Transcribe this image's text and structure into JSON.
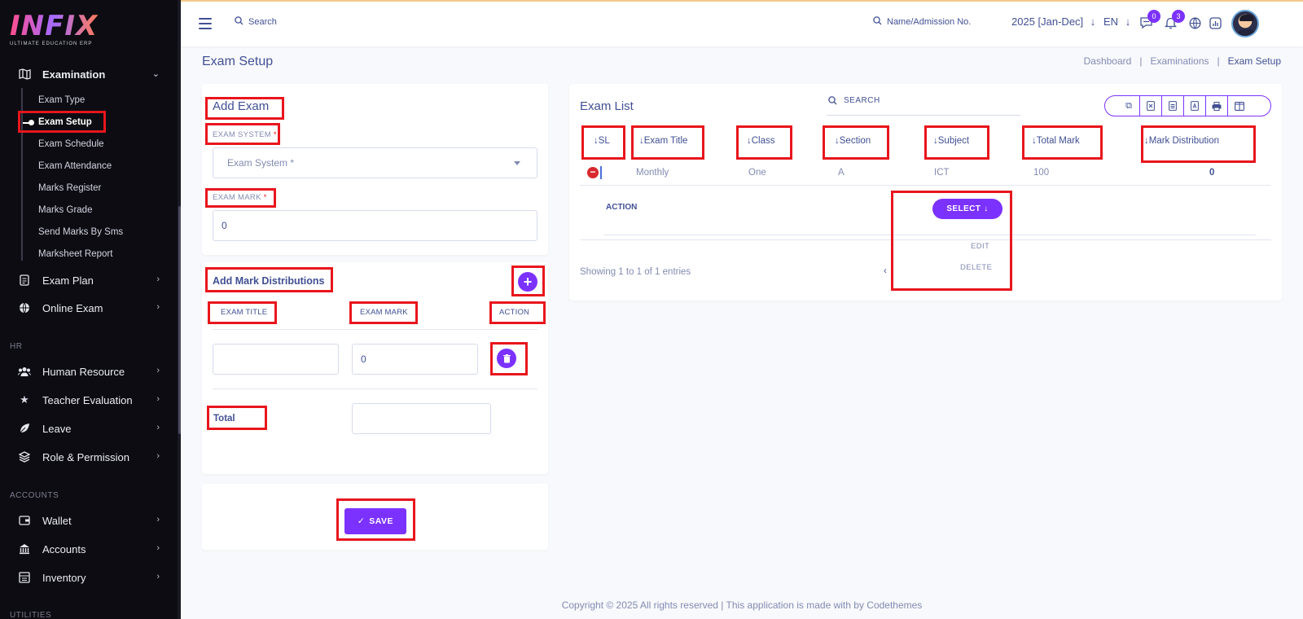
{
  "app": {
    "logo_text": "INFIX",
    "logo_sub": "ULTIMATE EDUCATION ERP"
  },
  "sidebar": {
    "examination": {
      "label": "Examination"
    },
    "sub_items": [
      {
        "label": "Exam Type"
      },
      {
        "label": "Exam Setup"
      },
      {
        "label": "Exam Schedule"
      },
      {
        "label": "Exam Attendance"
      },
      {
        "label": "Marks Register"
      },
      {
        "label": "Marks Grade"
      },
      {
        "label": "Send Marks By Sms"
      },
      {
        "label": "Marksheet Report"
      }
    ],
    "exam_plan": {
      "label": "Exam Plan"
    },
    "online_exam": {
      "label": "Online Exam"
    },
    "hr_section": "HR",
    "human_resource": {
      "label": "Human Resource"
    },
    "teacher_evaluation": {
      "label": "Teacher Evaluation"
    },
    "leave": {
      "label": "Leave"
    },
    "role_permission": {
      "label": "Role & Permission"
    },
    "accounts_section": "ACCOUNTS",
    "wallet": {
      "label": "Wallet"
    },
    "accounts": {
      "label": "Accounts"
    },
    "inventory": {
      "label": "Inventory"
    },
    "utilities_section": "UTILITIES"
  },
  "header": {
    "search_label": "Search",
    "name_search_label": "Name/Admission No.",
    "year": "2025 [Jan-Dec]",
    "lang": "EN",
    "messages_count": "0",
    "notifications_count": "3"
  },
  "page": {
    "title": "Exam Setup",
    "breadcrumb": [
      "Dashboard",
      "Examinations",
      "Exam Setup"
    ],
    "separator": "|"
  },
  "add_exam": {
    "title": "Add Exam",
    "exam_system_label": "EXAM SYSTEM",
    "required_mark": "*",
    "exam_system_placeholder": "Exam System *",
    "exam_mark_label": "EXAM MARK",
    "exam_mark_value": "0"
  },
  "mark_distributions": {
    "title": "Add Mark Distributions",
    "col_exam_title": "EXAM TITLE",
    "col_exam_mark": "EXAM MARK",
    "col_action": "ACTION",
    "row_title_value": "",
    "row_mark_value": "0",
    "total_label": "Total",
    "total_value": ""
  },
  "save": {
    "label": "SAVE"
  },
  "exam_list": {
    "title": "Exam List",
    "search_label": "SEARCH",
    "columns": [
      "SL",
      "Exam Title",
      "Class",
      "Section",
      "Subject",
      "Total Mark",
      "Mark Distribution"
    ],
    "row": {
      "exam_title": "Monthly",
      "class": "One",
      "section": "A",
      "subject": "ICT",
      "total_mark": "100",
      "mark_distribution": "0"
    },
    "action_label": "ACTION",
    "select_label": "SELECT",
    "menu_options": [
      "EDIT",
      "DELETE"
    ],
    "showing": "Showing 1 to 1 of 1 entries"
  },
  "footer": {
    "text": "Copyright © 2025 All rights reserved | This application is made with by Codethemes"
  },
  "colors": {
    "accent": "#7c32ff",
    "text": "#415094",
    "muted": "#828bb2",
    "highlight_box": "#e8161d",
    "sidebar_bg": "#0c0c12"
  }
}
